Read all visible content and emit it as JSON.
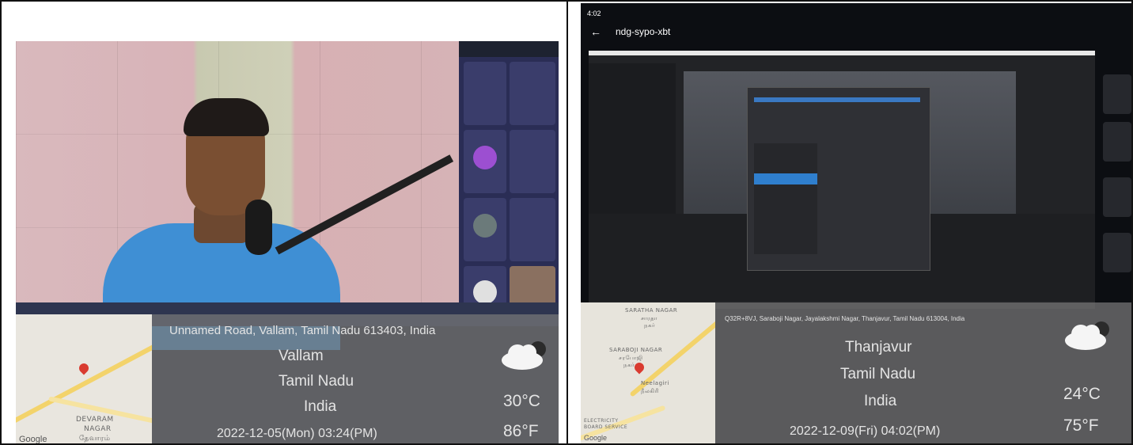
{
  "left": {
    "address": "Unnamed Road, Vallam, Tamil Nadu 613403, India",
    "city": "Vallam",
    "state": "Tamil Nadu",
    "country": "India",
    "datetime": "2022-12-05(Mon)  03:24(PM)",
    "temp_c": "30°C",
    "temp_f": "86°F",
    "map_label_1": "DEVARAM",
    "map_label_2": "NAGAR",
    "map_label_3": "தேவாரம்",
    "map_brand": "Google",
    "weather_icon": "cloudy-night-icon"
  },
  "right": {
    "status_time": "4:02",
    "meeting_title": "ndg-sypo-xbt",
    "address": "Q32R+8VJ, Saraboji Nagar, Jayalakshmi Nagar, Thanjavur, Tamil Nadu 613004, India",
    "city": "Thanjavur",
    "state": "Tamil Nadu",
    "country": "India",
    "datetime": "2022-12-09(Fri)  04:02(PM)",
    "temp_c": "24°C",
    "temp_f": "75°F",
    "map_label_1": "SARATHA NAGAR",
    "map_label_2": "சாரதா",
    "map_label_3": "நகர்",
    "map_label_4": "SARABOJI NAGAR",
    "map_label_5": "சரபோஜி",
    "map_label_6": "நகர்",
    "map_label_7": "Neelagiri",
    "map_label_8": "நீலகிரி",
    "map_label_9": "ELECTRICITY",
    "map_label_10": "BOARD SERVICE",
    "map_brand": "Google",
    "weather_icon": "cloudy-night-icon"
  }
}
